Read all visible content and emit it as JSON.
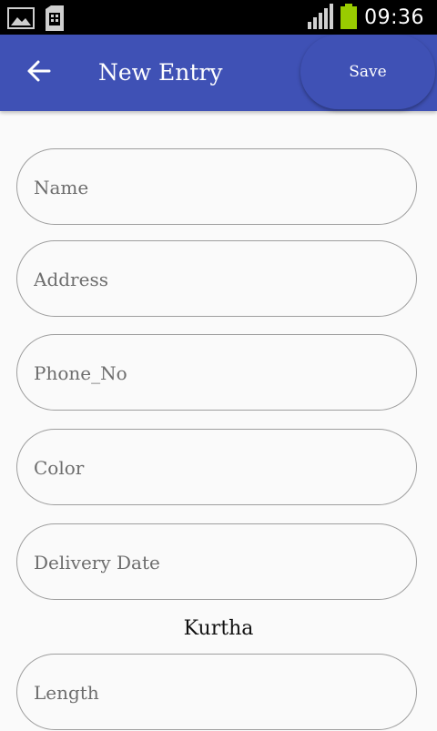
{
  "status_bar": {
    "time": "09:36",
    "icons": [
      "image-notification-icon",
      "sim-card-icon",
      "signal-icon",
      "battery-icon"
    ]
  },
  "app_bar": {
    "title": "New Entry",
    "save_label": "Save",
    "back_icon": "arrow-back-icon",
    "color": "#3f51b5"
  },
  "form": {
    "name_placeholder": "Name",
    "address_placeholder": "Address",
    "phone_placeholder": "Phone_No",
    "color_placeholder": "Color",
    "delivery_date_placeholder": "Delivery Date",
    "section_title": "Kurtha",
    "length_placeholder": "Length"
  }
}
